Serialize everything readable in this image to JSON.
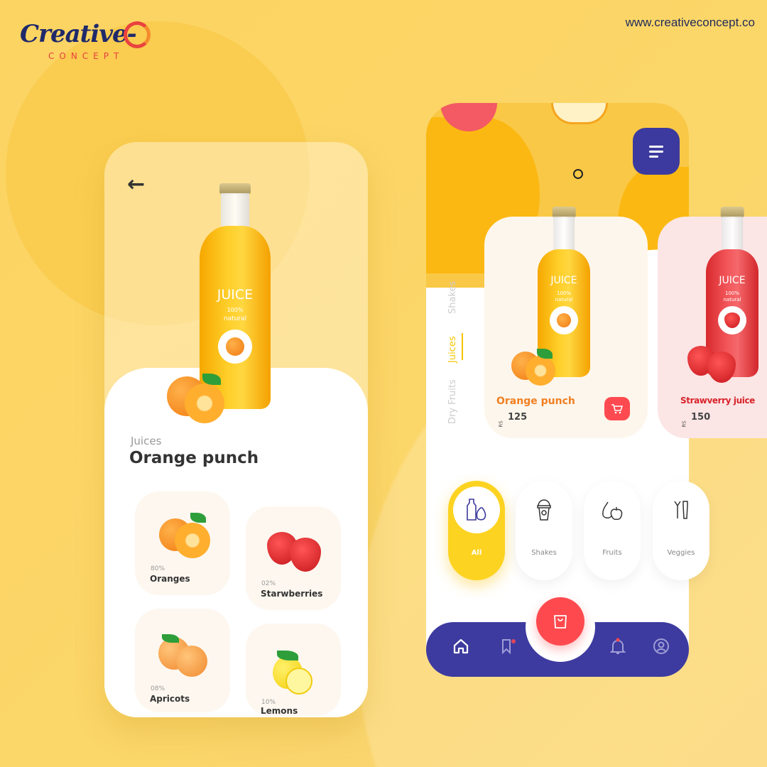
{
  "brand": {
    "logo_text": "Creative-",
    "logo_sub": "CONCEPT",
    "url": "www.creativeconcept.co"
  },
  "colors": {
    "accent_yellow": "#fdd321",
    "navy": "#3d3b9f",
    "red": "#fe4a4f",
    "orange_text": "#f07f22",
    "red_text": "#d8232a"
  },
  "detail": {
    "back_icon": "arrow-left-icon",
    "bottle": {
      "label": "JUICE",
      "sub1": "100%",
      "sub2": "natural"
    },
    "category": "Juices",
    "title": "Orange punch",
    "ingredients": [
      {
        "percent": "80%",
        "name": "Oranges"
      },
      {
        "percent": "02%",
        "name": "Starwberries"
      },
      {
        "percent": "08%",
        "name": "Apricots"
      },
      {
        "percent": "10%",
        "name": "Lemons"
      }
    ]
  },
  "home": {
    "menu_icon": "menu-icon",
    "side_tabs": [
      {
        "label": "Shakes",
        "active": false
      },
      {
        "label": "Juices",
        "active": true
      },
      {
        "label": "Dry Fruits",
        "active": false
      }
    ],
    "products": [
      {
        "name": "Orange punch",
        "currency": "RS",
        "price": "125",
        "bottle_label": "JUICE",
        "bottle_sub1": "100%",
        "bottle_sub2": "natural"
      },
      {
        "name": "Strawverry juice",
        "currency": "RS",
        "price": "150",
        "bottle_label": "JUICE",
        "bottle_sub1": "100%",
        "bottle_sub2": "natural"
      }
    ],
    "categories": [
      {
        "label": "All",
        "active": true
      },
      {
        "label": "Shakes"
      },
      {
        "label": "Fruits"
      },
      {
        "label": "Veggies"
      }
    ],
    "nav": [
      "home-icon",
      "bookmark-icon",
      "shopping-bag-icon",
      "bell-icon",
      "user-icon"
    ]
  }
}
